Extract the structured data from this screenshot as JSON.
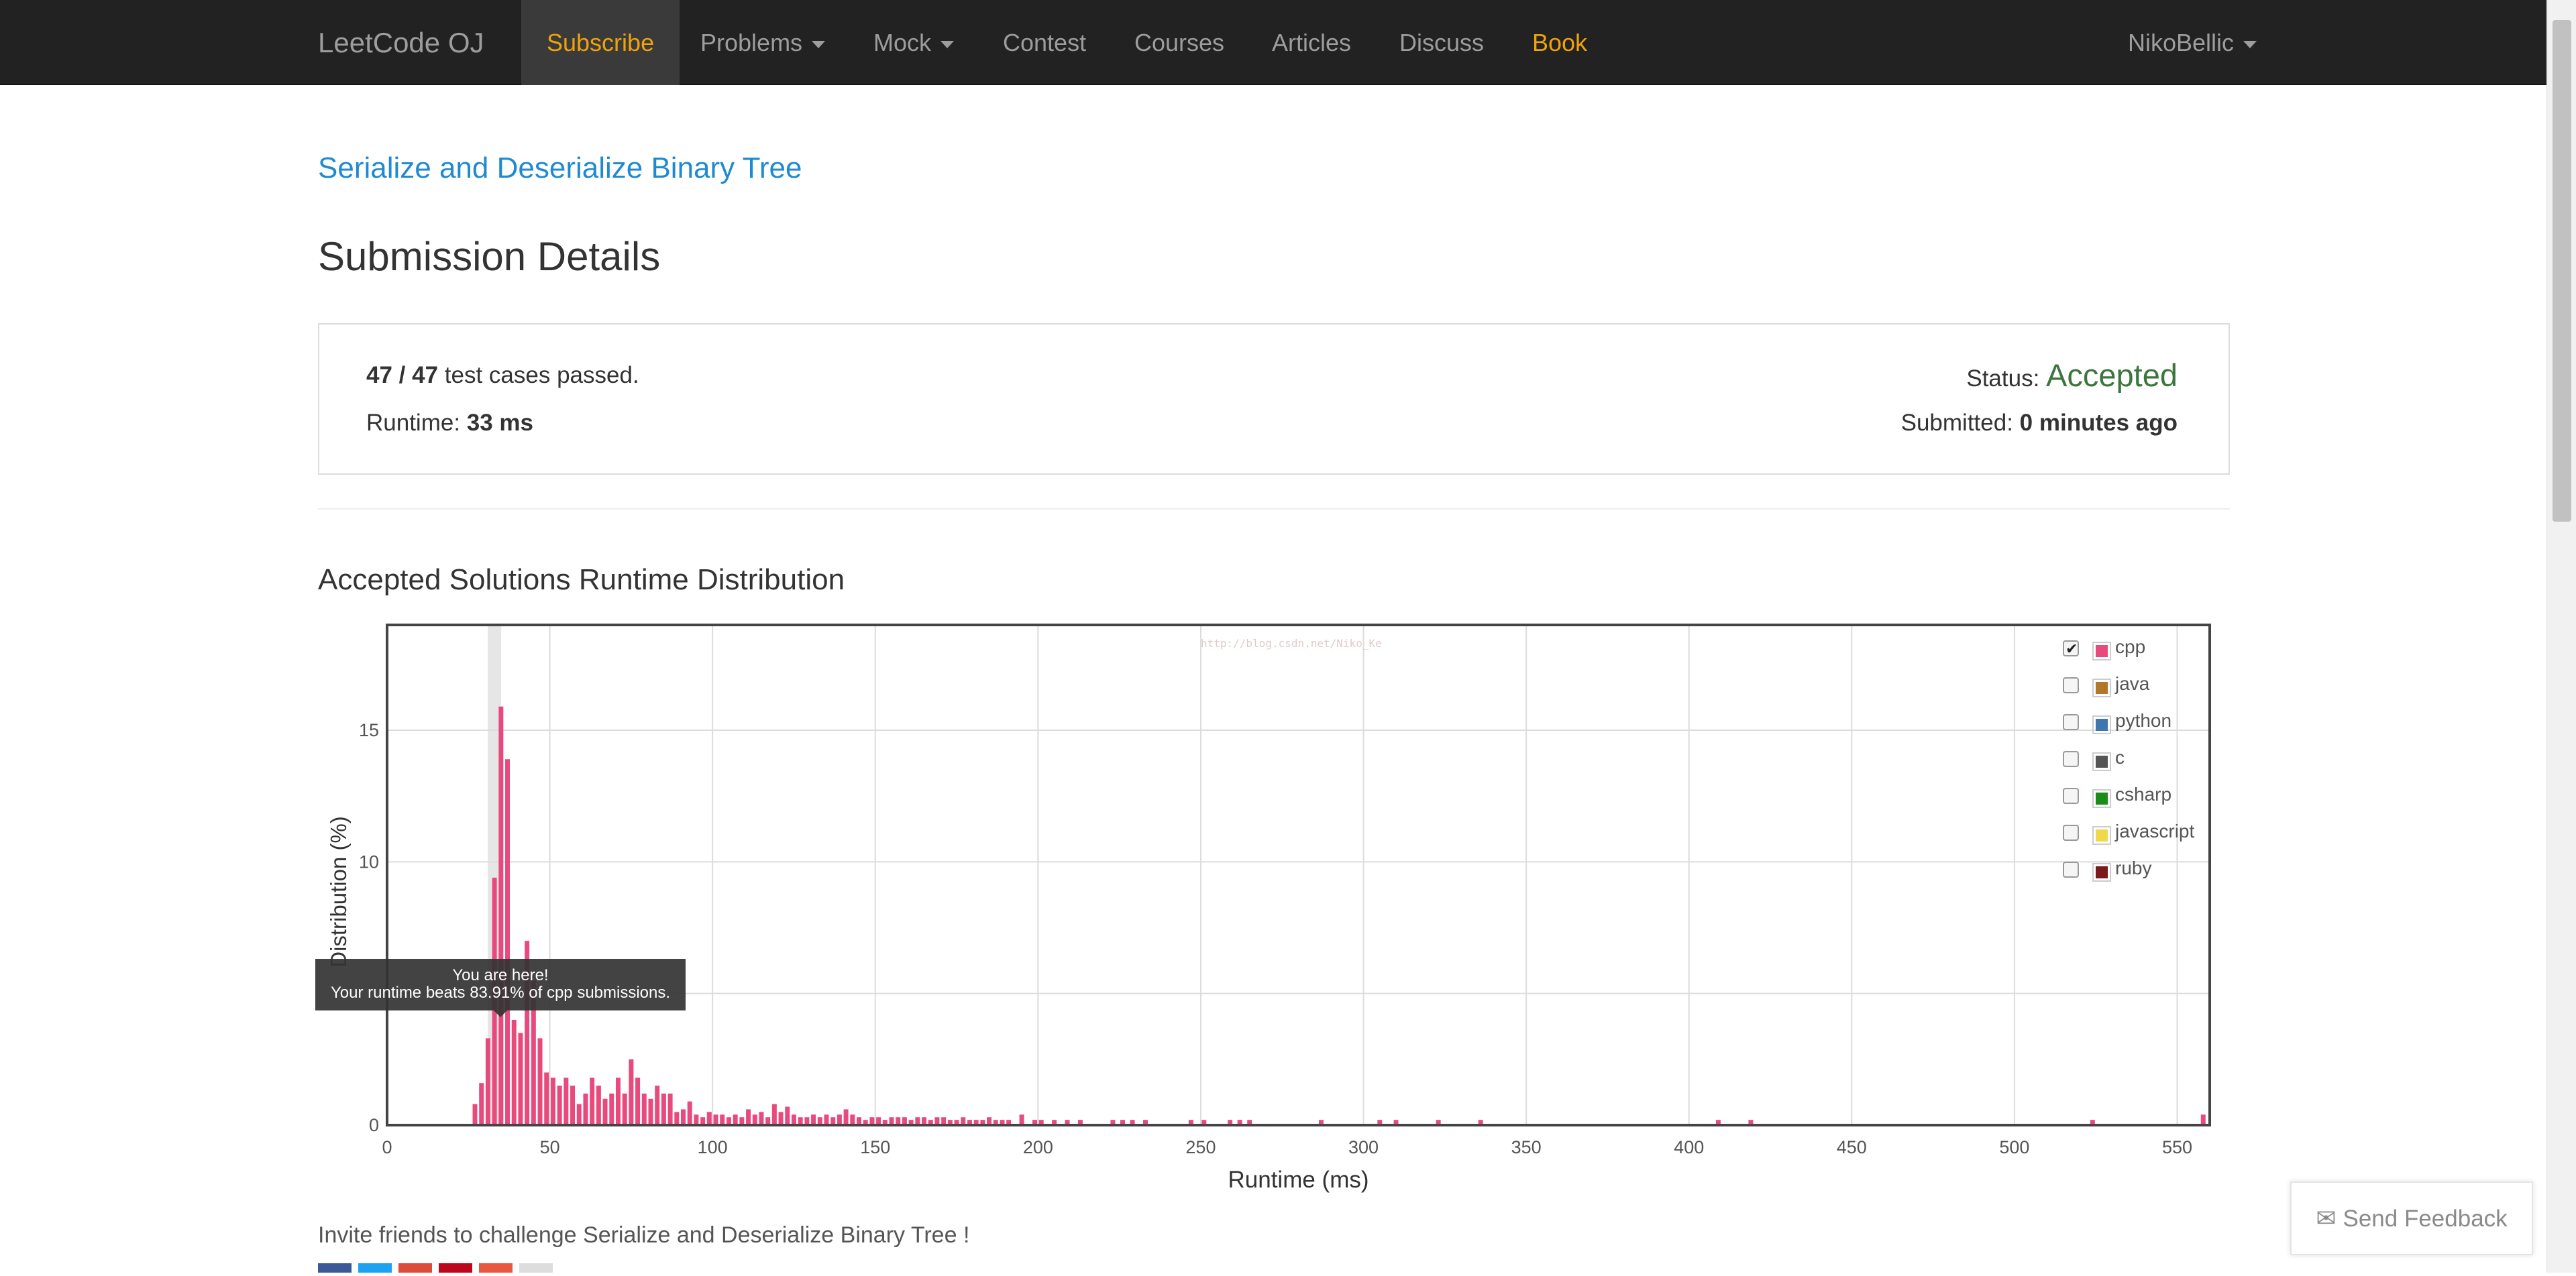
{
  "navbar": {
    "brand": "LeetCode OJ",
    "items": [
      {
        "label": "Subscribe",
        "caret": false
      },
      {
        "label": "Problems",
        "caret": true
      },
      {
        "label": "Mock",
        "caret": true
      },
      {
        "label": "Contest",
        "caret": false
      },
      {
        "label": "Courses",
        "caret": false
      },
      {
        "label": "Articles",
        "caret": false
      },
      {
        "label": "Discuss",
        "caret": false
      },
      {
        "label": "Book",
        "caret": false
      }
    ],
    "user": "NikoBellic"
  },
  "problem_title": "Serialize and Deserialize Binary Tree",
  "page_title": "Submission Details",
  "summary": {
    "passed": "47",
    "separator": " / ",
    "total": "47",
    "passed_text": " test cases passed.",
    "runtime_label": "Runtime: ",
    "runtime_value": "33 ms",
    "status_label": "Status: ",
    "status_value": "Accepted",
    "submitted_label": "Submitted: ",
    "submitted_value": "0 minutes ago"
  },
  "distribution_title": "Accepted Solutions Runtime Distribution",
  "tooltip": {
    "line1": "You are here!",
    "line2": "Your runtime beats 83.91% of cpp submissions."
  },
  "watermark": "http://blog.csdn.net/Niko_Ke",
  "invite_text": "Invite friends to challenge Serialize and Deserialize Binary Tree !",
  "feedback_label": "Send Feedback",
  "colors": {
    "accent_orange": "#f0a30a",
    "link_blue": "#1f8ad1",
    "accepted_green": "#3c763d",
    "cpp": "#e84a7e"
  },
  "legend": [
    {
      "label": "cpp",
      "color": "#e84a7e",
      "checked": true
    },
    {
      "label": "java",
      "color": "#b07828",
      "checked": false
    },
    {
      "label": "python",
      "color": "#3e76b0",
      "checked": false
    },
    {
      "label": "c",
      "color": "#555555",
      "checked": false
    },
    {
      "label": "csharp",
      "color": "#1a8c1a",
      "checked": false
    },
    {
      "label": "javascript",
      "color": "#f0d84a",
      "checked": false
    },
    {
      "label": "ruby",
      "color": "#7a1a1a",
      "checked": false
    }
  ],
  "share_colors": [
    "#3b5998",
    "#1da1f2",
    "#dd4b39",
    "#bd081c",
    "#e9573f",
    "#dddddd"
  ],
  "chart_data": {
    "type": "bar",
    "xlabel": "Runtime (ms)",
    "ylabel": "Distribution (%)",
    "xlim": [
      0,
      560
    ],
    "ylim": [
      0,
      19
    ],
    "xticks": [
      0,
      50,
      100,
      150,
      200,
      250,
      300,
      350,
      400,
      450,
      500,
      550
    ],
    "yticks": [
      0,
      5,
      10,
      15
    ],
    "ytick_labels": [
      "0",
      "",
      "10",
      "15"
    ],
    "highlight_x": 33,
    "series": [
      {
        "name": "cpp",
        "color": "#e84a7e",
        "x": [
          27,
          29,
          31,
          33,
          35,
          37,
          39,
          41,
          43,
          45,
          47,
          49,
          51,
          53,
          55,
          57,
          59,
          61,
          63,
          65,
          67,
          69,
          71,
          73,
          75,
          77,
          79,
          81,
          83,
          85,
          87,
          89,
          91,
          93,
          95,
          97,
          99,
          101,
          103,
          105,
          107,
          109,
          111,
          113,
          115,
          117,
          119,
          121,
          123,
          125,
          127,
          129,
          131,
          133,
          135,
          137,
          139,
          141,
          143,
          145,
          147,
          149,
          151,
          153,
          155,
          157,
          159,
          161,
          163,
          165,
          167,
          169,
          171,
          173,
          175,
          177,
          179,
          181,
          183,
          185,
          187,
          189,
          191,
          195,
          199,
          201,
          205,
          209,
          213,
          223,
          226,
          229,
          233,
          247,
          251,
          259,
          262,
          265,
          287,
          305,
          310,
          323,
          336,
          409,
          419,
          524,
          558
        ],
        "values": [
          0.8,
          1.6,
          3.3,
          9.4,
          15.9,
          13.9,
          4.0,
          3.5,
          7.0,
          5.5,
          3.3,
          2.0,
          1.8,
          1.5,
          1.8,
          1.5,
          0.8,
          1.2,
          1.8,
          1.5,
          1.0,
          1.2,
          1.8,
          1.2,
          2.5,
          1.8,
          1.2,
          1.0,
          1.5,
          1.2,
          1.2,
          0.5,
          0.6,
          0.9,
          0.4,
          0.3,
          0.5,
          0.4,
          0.4,
          0.3,
          0.4,
          0.3,
          0.6,
          0.4,
          0.5,
          0.3,
          0.8,
          0.5,
          0.7,
          0.4,
          0.3,
          0.3,
          0.4,
          0.3,
          0.4,
          0.3,
          0.4,
          0.6,
          0.4,
          0.3,
          0.2,
          0.3,
          0.3,
          0.2,
          0.3,
          0.3,
          0.3,
          0.2,
          0.3,
          0.3,
          0.2,
          0.3,
          0.3,
          0.2,
          0.2,
          0.3,
          0.2,
          0.2,
          0.2,
          0.3,
          0.2,
          0.2,
          0.2,
          0.4,
          0.2,
          0.2,
          0.2,
          0.2,
          0.2,
          0.2,
          0.2,
          0.2,
          0.2,
          0.2,
          0.2,
          0.2,
          0.2,
          0.2,
          0.2,
          0.2,
          0.2,
          0.2,
          0.2,
          0.2,
          0.2,
          0.2,
          0.4
        ]
      }
    ]
  }
}
